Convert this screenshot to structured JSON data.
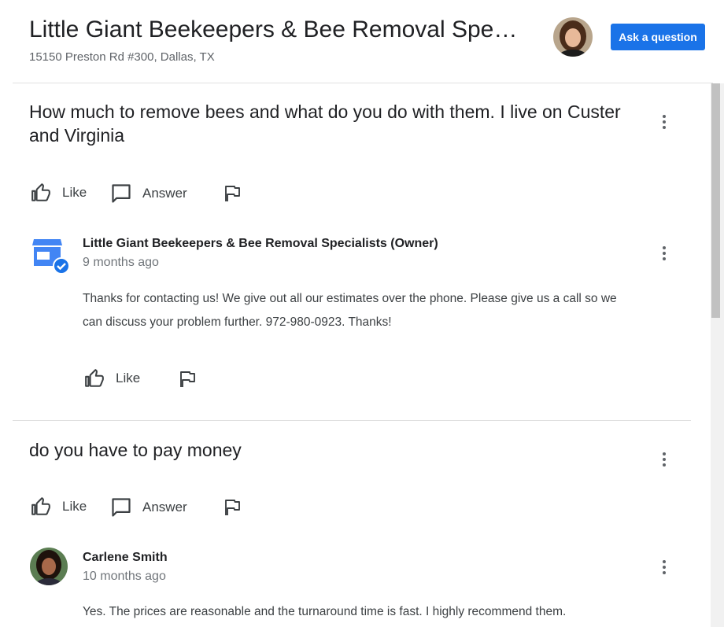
{
  "header": {
    "title": "Little Giant Beekeepers & Bee Removal Specialists",
    "address": "15150 Preston Rd #300, Dallas, TX",
    "ask_button": "Ask a question"
  },
  "questions": [
    {
      "text": "How much to remove bees and what do you do with them. I live on Custer and Virginia",
      "like_label": "Like",
      "answer_label": "Answer",
      "answer": {
        "author": "Little Giant Beekeepers & Bee Removal Specialists (Owner)",
        "time": "9 months ago",
        "text": "Thanks for contacting us! We give out all our estimates over the phone. Please give us a call so we can discuss your problem further. 972-980-0923. Thanks!",
        "like_label": "Like"
      }
    },
    {
      "text": "do you have to pay money",
      "like_label": "Like",
      "answer_label": "Answer",
      "answer": {
        "author": "Carlene Smith",
        "time": "10 months ago",
        "text": "Yes. The prices are reasonable and the turnaround time is fast. I highly recommend them."
      }
    }
  ],
  "colors": {
    "accent": "#1a73e8",
    "text": "#202124",
    "secondary": "#5f6368"
  }
}
